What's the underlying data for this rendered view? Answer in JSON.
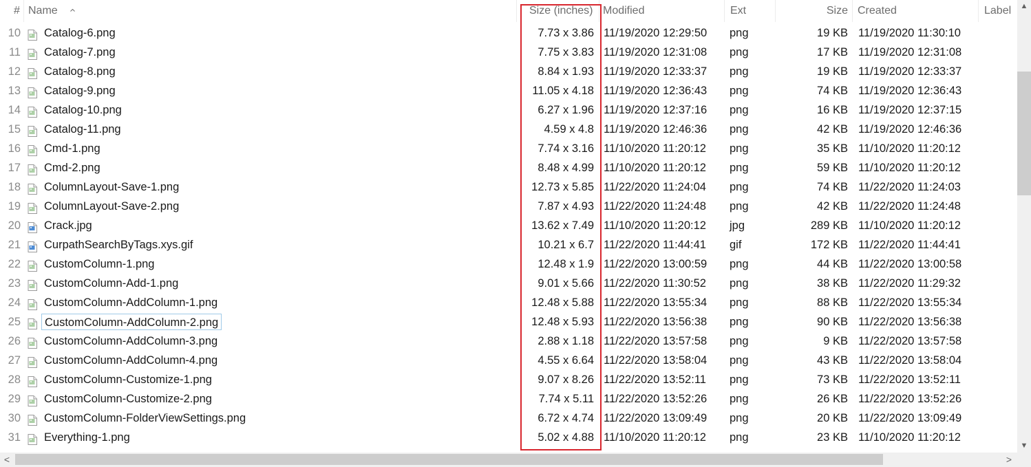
{
  "columns": {
    "num": "#",
    "name": "Name",
    "dimensions": "Size (inches)",
    "modified": "Modified",
    "ext": "Ext",
    "size": "Size",
    "created": "Created",
    "label": "Label"
  },
  "sort": {
    "column": "name",
    "direction": "ascending",
    "icon": "sort-ascending-icon"
  },
  "highlighted_column": "dimensions",
  "focused_row_index": 15,
  "colors": {
    "highlight_border": "#d8262e",
    "focus_border": "#9fcae8",
    "png_icon": "#6aaa5f",
    "picture_icon": "#3b7fcf"
  },
  "rows": [
    {
      "num": "10",
      "name": "Catalog-6.png",
      "dimensions": "7.73 x 3.86",
      "modified": "11/19/2020 12:29:50",
      "ext": "png",
      "size": "19 KB",
      "created": "11/19/2020 11:30:10",
      "icon": "png-file-icon"
    },
    {
      "num": "11",
      "name": "Catalog-7.png",
      "dimensions": "7.75 x 3.83",
      "modified": "11/19/2020 12:31:08",
      "ext": "png",
      "size": "17 KB",
      "created": "11/19/2020 12:31:08",
      "icon": "png-file-icon"
    },
    {
      "num": "12",
      "name": "Catalog-8.png",
      "dimensions": "8.84 x 1.93",
      "modified": "11/19/2020 12:33:37",
      "ext": "png",
      "size": "19 KB",
      "created": "11/19/2020 12:33:37",
      "icon": "png-file-icon"
    },
    {
      "num": "13",
      "name": "Catalog-9.png",
      "dimensions": "11.05 x 4.18",
      "modified": "11/19/2020 12:36:43",
      "ext": "png",
      "size": "74 KB",
      "created": "11/19/2020 12:36:43",
      "icon": "png-file-icon"
    },
    {
      "num": "14",
      "name": "Catalog-10.png",
      "dimensions": "6.27 x 1.96",
      "modified": "11/19/2020 12:37:16",
      "ext": "png",
      "size": "16 KB",
      "created": "11/19/2020 12:37:15",
      "icon": "png-file-icon"
    },
    {
      "num": "15",
      "name": "Catalog-11.png",
      "dimensions": "4.59 x 4.8",
      "modified": "11/19/2020 12:46:36",
      "ext": "png",
      "size": "42 KB",
      "created": "11/19/2020 12:46:36",
      "icon": "png-file-icon"
    },
    {
      "num": "16",
      "name": "Cmd-1.png",
      "dimensions": "7.74 x 3.16",
      "modified": "11/10/2020 11:20:12",
      "ext": "png",
      "size": "35 KB",
      "created": "11/10/2020 11:20:12",
      "icon": "png-file-icon"
    },
    {
      "num": "17",
      "name": "Cmd-2.png",
      "dimensions": "8.48 x 4.99",
      "modified": "11/10/2020 11:20:12",
      "ext": "png",
      "size": "59 KB",
      "created": "11/10/2020 11:20:12",
      "icon": "png-file-icon"
    },
    {
      "num": "18",
      "name": "ColumnLayout-Save-1.png",
      "dimensions": "12.73 x 5.85",
      "modified": "11/22/2020 11:24:04",
      "ext": "png",
      "size": "74 KB",
      "created": "11/22/2020 11:24:03",
      "icon": "png-file-icon"
    },
    {
      "num": "19",
      "name": "ColumnLayout-Save-2.png",
      "dimensions": "7.87 x 4.93",
      "modified": "11/22/2020 11:24:48",
      "ext": "png",
      "size": "42 KB",
      "created": "11/22/2020 11:24:48",
      "icon": "png-file-icon"
    },
    {
      "num": "20",
      "name": "Crack.jpg",
      "dimensions": "13.62 x 7.49",
      "modified": "11/10/2020 11:20:12",
      "ext": "jpg",
      "size": "289 KB",
      "created": "11/10/2020 11:20:12",
      "icon": "jpg-file-icon"
    },
    {
      "num": "21",
      "name": "CurpathSearchByTags.xys.gif",
      "dimensions": "10.21 x 6.7",
      "modified": "11/22/2020 11:44:41",
      "ext": "gif",
      "size": "172 KB",
      "created": "11/22/2020 11:44:41",
      "icon": "gif-file-icon"
    },
    {
      "num": "22",
      "name": "CustomColumn-1.png",
      "dimensions": "12.48 x 1.9",
      "modified": "11/22/2020 13:00:59",
      "ext": "png",
      "size": "44 KB",
      "created": "11/22/2020 13:00:58",
      "icon": "png-file-icon"
    },
    {
      "num": "23",
      "name": "CustomColumn-Add-1.png",
      "dimensions": "9.01 x 5.66",
      "modified": "11/22/2020 11:30:52",
      "ext": "png",
      "size": "38 KB",
      "created": "11/22/2020 11:29:32",
      "icon": "png-file-icon"
    },
    {
      "num": "24",
      "name": "CustomColumn-AddColumn-1.png",
      "dimensions": "12.48 x 5.88",
      "modified": "11/22/2020 13:55:34",
      "ext": "png",
      "size": "88 KB",
      "created": "11/22/2020 13:55:34",
      "icon": "png-file-icon"
    },
    {
      "num": "25",
      "name": "CustomColumn-AddColumn-2.png",
      "dimensions": "12.48 x 5.93",
      "modified": "11/22/2020 13:56:38",
      "ext": "png",
      "size": "90 KB",
      "created": "11/22/2020 13:56:38",
      "icon": "png-file-icon"
    },
    {
      "num": "26",
      "name": "CustomColumn-AddColumn-3.png",
      "dimensions": "2.88 x 1.18",
      "modified": "11/22/2020 13:57:58",
      "ext": "png",
      "size": "9 KB",
      "created": "11/22/2020 13:57:58",
      "icon": "png-file-icon"
    },
    {
      "num": "27",
      "name": "CustomColumn-AddColumn-4.png",
      "dimensions": "4.55 x 6.64",
      "modified": "11/22/2020 13:58:04",
      "ext": "png",
      "size": "43 KB",
      "created": "11/22/2020 13:58:04",
      "icon": "png-file-icon"
    },
    {
      "num": "28",
      "name": "CustomColumn-Customize-1.png",
      "dimensions": "9.07 x 8.26",
      "modified": "11/22/2020 13:52:11",
      "ext": "png",
      "size": "73 KB",
      "created": "11/22/2020 13:52:11",
      "icon": "png-file-icon"
    },
    {
      "num": "29",
      "name": "CustomColumn-Customize-2.png",
      "dimensions": "7.74 x 5.11",
      "modified": "11/22/2020 13:52:26",
      "ext": "png",
      "size": "26 KB",
      "created": "11/22/2020 13:52:26",
      "icon": "png-file-icon"
    },
    {
      "num": "30",
      "name": "CustomColumn-FolderViewSettings.png",
      "dimensions": "6.72 x 4.74",
      "modified": "11/22/2020 13:09:49",
      "ext": "png",
      "size": "20 KB",
      "created": "11/22/2020 13:09:49",
      "icon": "png-file-icon"
    },
    {
      "num": "31",
      "name": "Everything-1.png",
      "dimensions": "5.02 x 4.88",
      "modified": "11/10/2020 11:20:12",
      "ext": "png",
      "size": "23 KB",
      "created": "11/10/2020 11:20:12",
      "icon": "png-file-icon"
    }
  ],
  "scrollbar": {
    "up": "▲",
    "down": "▼",
    "left": "<",
    "right": ">"
  }
}
